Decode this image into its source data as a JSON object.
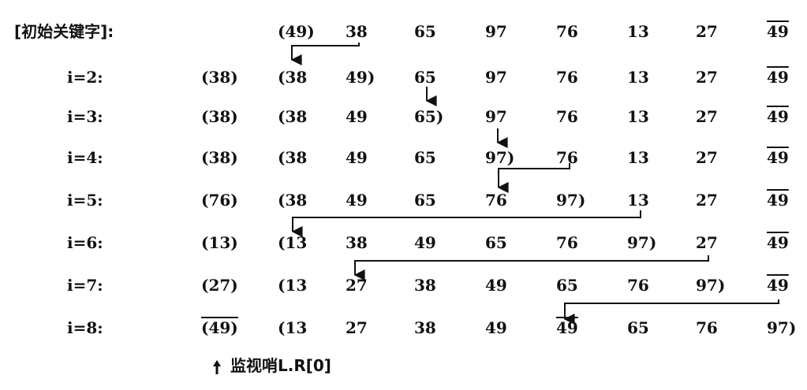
{
  "title": "[初始关键字]:",
  "initial": {
    "keys": [
      "(49)",
      "38",
      "65",
      "97",
      "76",
      "13",
      "27",
      "49"
    ],
    "overlined": [
      false,
      false,
      false,
      false,
      false,
      false,
      false,
      true
    ]
  },
  "passes": [
    {
      "label": "i=2:",
      "sentinel": "(38)",
      "sentinel_overline": false,
      "keys": [
        "(38",
        "49)",
        "65",
        "97",
        "76",
        "13",
        "27",
        "49"
      ],
      "overlined": [
        false,
        false,
        false,
        false,
        false,
        false,
        false,
        true
      ]
    },
    {
      "label": "i=3:",
      "sentinel": "(38)",
      "sentinel_overline": false,
      "keys": [
        "(38",
        "49",
        "65)",
        "97",
        "76",
        "13",
        "27",
        "49"
      ],
      "overlined": [
        false,
        false,
        false,
        false,
        false,
        false,
        false,
        true
      ]
    },
    {
      "label": "i=4:",
      "sentinel": "(38)",
      "sentinel_overline": false,
      "keys": [
        "(38",
        "49",
        "65",
        "97)",
        "76",
        "13",
        "27",
        "49"
      ],
      "overlined": [
        false,
        false,
        false,
        false,
        false,
        false,
        false,
        true
      ]
    },
    {
      "label": "i=5:",
      "sentinel": "(76)",
      "sentinel_overline": false,
      "keys": [
        "(38",
        "49",
        "65",
        "76",
        "97)",
        "13",
        "27",
        "49"
      ],
      "overlined": [
        false,
        false,
        false,
        false,
        false,
        false,
        false,
        true
      ]
    },
    {
      "label": "i=6:",
      "sentinel": "(13)",
      "sentinel_overline": false,
      "keys": [
        "(13",
        "38",
        "49",
        "65",
        "76",
        "97)",
        "27",
        "49"
      ],
      "overlined": [
        false,
        false,
        false,
        false,
        false,
        false,
        false,
        true
      ]
    },
    {
      "label": "i=7:",
      "sentinel": "(27)",
      "sentinel_overline": false,
      "keys": [
        "(13",
        "27",
        "38",
        "49",
        "65",
        "76",
        "97)",
        "49"
      ],
      "overlined": [
        false,
        false,
        false,
        false,
        false,
        false,
        false,
        true
      ]
    },
    {
      "label": "i=8:",
      "sentinel": "(49)",
      "sentinel_overline": true,
      "keys": [
        "(13",
        "27",
        "38",
        "49",
        "49",
        "65",
        "76",
        "97)"
      ],
      "overlined": [
        false,
        false,
        false,
        false,
        true,
        false,
        false,
        false
      ]
    }
  ],
  "legend": "监视哨L.R[0]",
  "icons": {
    "legend_arrow": "up-arrow-icon",
    "move_arrow": "down-arrow-icon"
  }
}
